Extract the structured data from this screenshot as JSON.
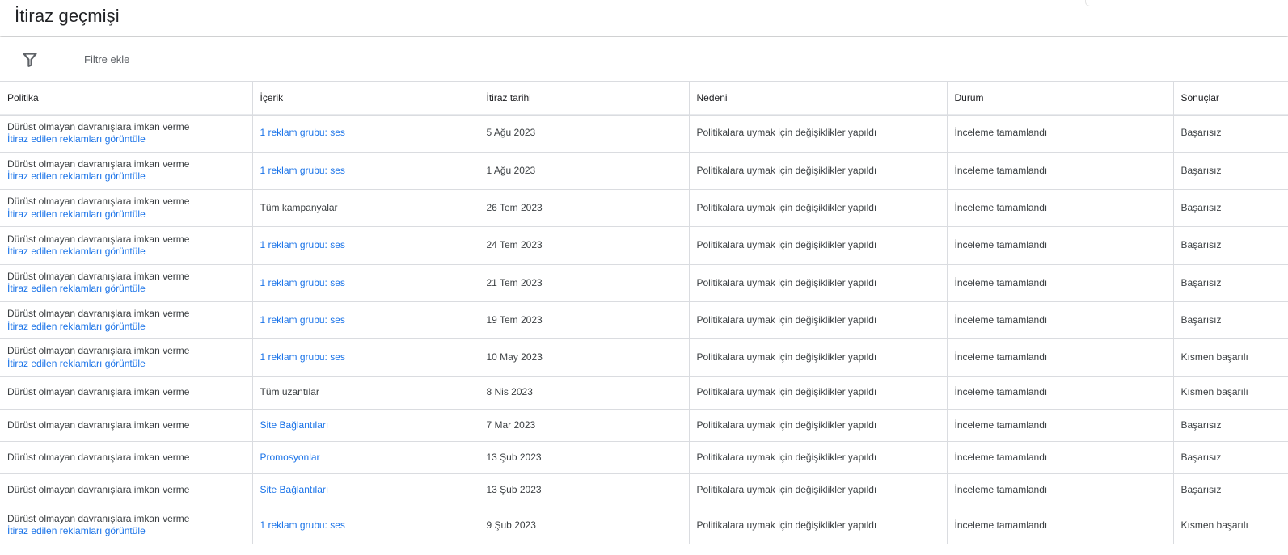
{
  "header": {
    "title": "İtiraz geçmişi"
  },
  "filter_bar": {
    "icon": "filter-icon",
    "label": "Filtre ekle"
  },
  "colors": {
    "link": "#1a73e8",
    "text": "#3c4043",
    "border": "#dadce0"
  },
  "table": {
    "columns": [
      "Politika",
      "İçerik",
      "İtiraz tarihi",
      "Nedeni",
      "Durum",
      "Sonuçlar"
    ],
    "rows": [
      {
        "policy": "Dürüst olmayan davranışlara imkan verme",
        "view_link": "İtiraz edilen reklamları görüntüle",
        "content": "1 reklam grubu: ses",
        "content_is_link": true,
        "date": "5 Ağu 2023",
        "reason": "Politikalara uymak için değişiklikler yapıldı",
        "status": "İnceleme tamamlandı",
        "result": "Başarısız"
      },
      {
        "policy": "Dürüst olmayan davranışlara imkan verme",
        "view_link": "İtiraz edilen reklamları görüntüle",
        "content": "1 reklam grubu: ses",
        "content_is_link": true,
        "date": "1 Ağu 2023",
        "reason": "Politikalara uymak için değişiklikler yapıldı",
        "status": "İnceleme tamamlandı",
        "result": "Başarısız"
      },
      {
        "policy": "Dürüst olmayan davranışlara imkan verme",
        "view_link": "İtiraz edilen reklamları görüntüle",
        "content": "Tüm kampanyalar",
        "content_is_link": false,
        "date": "26 Tem 2023",
        "reason": "Politikalara uymak için değişiklikler yapıldı",
        "status": "İnceleme tamamlandı",
        "result": "Başarısız"
      },
      {
        "policy": "Dürüst olmayan davranışlara imkan verme",
        "view_link": "İtiraz edilen reklamları görüntüle",
        "content": "1 reklam grubu: ses",
        "content_is_link": true,
        "date": "24 Tem 2023",
        "reason": "Politikalara uymak için değişiklikler yapıldı",
        "status": "İnceleme tamamlandı",
        "result": "Başarısız"
      },
      {
        "policy": "Dürüst olmayan davranışlara imkan verme",
        "view_link": "İtiraz edilen reklamları görüntüle",
        "content": "1 reklam grubu: ses",
        "content_is_link": true,
        "date": "21 Tem 2023",
        "reason": "Politikalara uymak için değişiklikler yapıldı",
        "status": "İnceleme tamamlandı",
        "result": "Başarısız"
      },
      {
        "policy": "Dürüst olmayan davranışlara imkan verme",
        "view_link": "İtiraz edilen reklamları görüntüle",
        "content": "1 reklam grubu: ses",
        "content_is_link": true,
        "date": "19 Tem 2023",
        "reason": "Politikalara uymak için değişiklikler yapıldı",
        "status": "İnceleme tamamlandı",
        "result": "Başarısız"
      },
      {
        "policy": "Dürüst olmayan davranışlara imkan verme",
        "view_link": "İtiraz edilen reklamları görüntüle",
        "content": "1 reklam grubu: ses",
        "content_is_link": true,
        "date": "10 May 2023",
        "reason": "Politikalara uymak için değişiklikler yapıldı",
        "status": "İnceleme tamamlandı",
        "result": "Kısmen başarılı"
      },
      {
        "policy": "Dürüst olmayan davranışlara imkan verme",
        "view_link": "",
        "content": "Tüm uzantılar",
        "content_is_link": false,
        "date": "8 Nis 2023",
        "reason": "Politikalara uymak için değişiklikler yapıldı",
        "status": "İnceleme tamamlandı",
        "result": "Kısmen başarılı"
      },
      {
        "policy": "Dürüst olmayan davranışlara imkan verme",
        "view_link": "",
        "content": "Site Bağlantıları",
        "content_is_link": true,
        "date": "7 Mar 2023",
        "reason": "Politikalara uymak için değişiklikler yapıldı",
        "status": "İnceleme tamamlandı",
        "result": "Başarısız"
      },
      {
        "policy": "Dürüst olmayan davranışlara imkan verme",
        "view_link": "",
        "content": "Promosyonlar",
        "content_is_link": true,
        "date": "13 Şub 2023",
        "reason": "Politikalara uymak için değişiklikler yapıldı",
        "status": "İnceleme tamamlandı",
        "result": "Başarısız"
      },
      {
        "policy": "Dürüst olmayan davranışlara imkan verme",
        "view_link": "",
        "content": "Site Bağlantıları",
        "content_is_link": true,
        "date": "13 Şub 2023",
        "reason": "Politikalara uymak için değişiklikler yapıldı",
        "status": "İnceleme tamamlandı",
        "result": "Başarısız"
      },
      {
        "policy": "Dürüst olmayan davranışlara imkan verme",
        "view_link": "İtiraz edilen reklamları görüntüle",
        "content": "1 reklam grubu: ses",
        "content_is_link": true,
        "date": "9 Şub 2023",
        "reason": "Politikalara uymak için değişiklikler yapıldı",
        "status": "İnceleme tamamlandı",
        "result": "Kısmen başarılı"
      }
    ]
  }
}
